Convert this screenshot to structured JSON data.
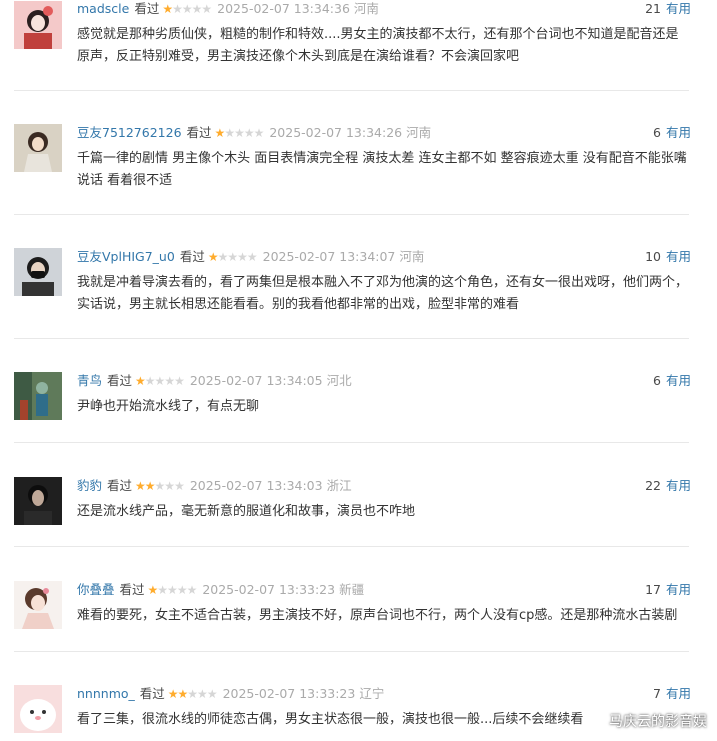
{
  "comments": [
    {
      "username": "madscle",
      "watched": "看过",
      "rating": 1,
      "time": "2025-02-07 13:34:36",
      "location": "河南",
      "votes": "21",
      "useful_label": "有用",
      "text": "感觉就是那种劣质仙侠，粗糙的制作和特效....男女主的演技都不太行，还有那个台词也不知道是配音还是原声，反正特别难受，男主演技还像个木头到底是在演给谁看？不会演回家吧"
    },
    {
      "username": "豆友7512762126",
      "watched": "看过",
      "rating": 1,
      "time": "2025-02-07 13:34:26",
      "location": "河南",
      "votes": "6",
      "useful_label": "有用",
      "text": "千篇一律的剧情 男主像个木头 面目表情演完全程 演技太差 连女主都不如 整容痕迹太重 没有配音不能张嘴说话 看着很不适"
    },
    {
      "username": "豆友VplHIG7_u0",
      "watched": "看过",
      "rating": 1,
      "time": "2025-02-07 13:34:07",
      "location": "河南",
      "votes": "10",
      "useful_label": "有用",
      "text": "我就是冲着导演去看的，看了两集但是根本融入不了邓为他演的这个角色，还有女一很出戏呀，他们两个，实话说，男主就长相思还能看看。别的我看他都非常的出戏，脸型非常的难看"
    },
    {
      "username": "青鸟",
      "watched": "看过",
      "rating": 1,
      "time": "2025-02-07 13:34:05",
      "location": "河北",
      "votes": "6",
      "useful_label": "有用",
      "text": "尹峥也开始流水线了，有点无聊"
    },
    {
      "username": "豹豹",
      "watched": "看过",
      "rating": 2,
      "time": "2025-02-07 13:34:03",
      "location": "浙江",
      "votes": "22",
      "useful_label": "有用",
      "text": "还是流水线产品，毫无新意的服道化和故事，演员也不咋地"
    },
    {
      "username": "你叠叠",
      "watched": "看过",
      "rating": 1,
      "time": "2025-02-07 13:33:23",
      "location": "新疆",
      "votes": "17",
      "useful_label": "有用",
      "text": "难看的要死，女主不适合古装，男主演技不好，原声台词也不行，两个人没有cp感。还是那种流水古装剧"
    },
    {
      "username": "nnnnmo_",
      "watched": "看过",
      "rating": 2,
      "time": "2025-02-07 13:33:23",
      "location": "辽宁",
      "votes": "7",
      "useful_label": "有用",
      "text": "看了三集，很流水线的师徒恋古偶，男女主状态很一般，演技也很一般...后续不会继续看"
    }
  ],
  "watermark": "马庆云的影音娱"
}
